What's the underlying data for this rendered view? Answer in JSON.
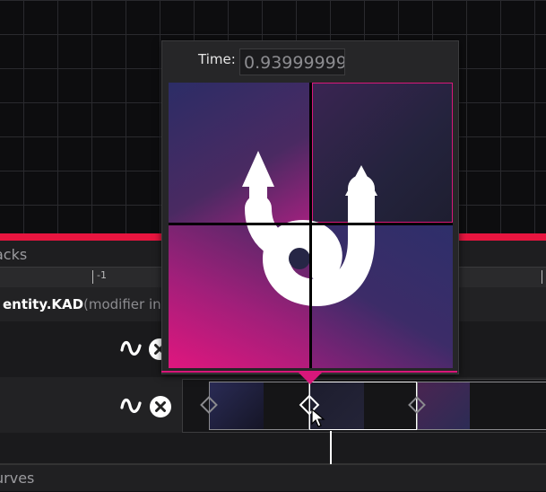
{
  "timeline": {
    "tracks_label": "acks",
    "ruler_tick_label": "-1",
    "entity_name": "entity.KAD",
    "entity_modifier": "(modifier in",
    "curves_label": "urves"
  },
  "popup": {
    "time_label": "Time:",
    "time_value": "0.93999999"
  },
  "colors": {
    "accent_red": "#e8153f",
    "accent_magenta": "#d8177a",
    "tile_gradient_start": "#e0167e",
    "tile_gradient_end": "#2e2f6a"
  },
  "icons": {
    "curve": "curve-icon",
    "remove": "close-circle-icon",
    "logo": "double-arrow-logo"
  }
}
